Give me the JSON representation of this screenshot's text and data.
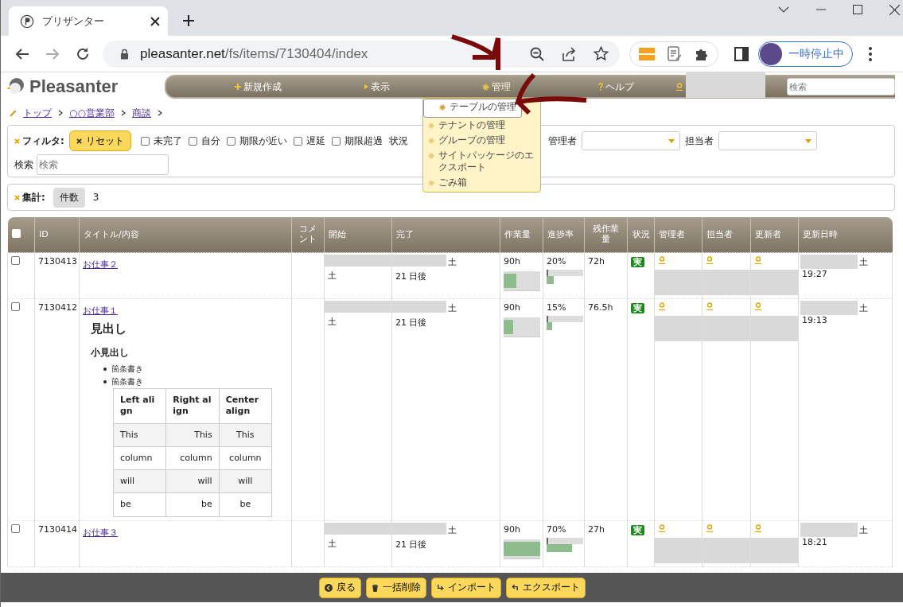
{
  "browser": {
    "tab_title": "プリザンター",
    "url_host": "pleasanter.net",
    "url_path": "/fs/items/7130404/index",
    "profile_label": "一時停止中"
  },
  "app": {
    "logo": "Pleasanter",
    "menu": [
      {
        "label": "新規作成",
        "kind": "plus",
        "expanded": false
      },
      {
        "label": "表示",
        "kind": "arrow",
        "expanded": false
      },
      {
        "label": "管理",
        "kind": "gear",
        "expanded": true
      },
      {
        "label": "ヘルプ",
        "kind": "help",
        "expanded": false
      }
    ],
    "search": {
      "placeholder": "検索"
    },
    "dropdown": [
      {
        "label": "テーブルの管理",
        "selected": true
      },
      {
        "label": "テナントの管理",
        "selected": false
      },
      {
        "label": "グループの管理",
        "selected": false
      },
      {
        "label": "サイトパッケージのエクスポート",
        "selected": false
      },
      {
        "label": "ごみ箱",
        "selected": false
      }
    ]
  },
  "breadcrumb": [
    "トップ",
    "○○営業部",
    "商談"
  ],
  "filter": {
    "label": "フィルタ:",
    "reset": "リセット",
    "checkboxes": [
      {
        "label": "未完了",
        "checked": false
      },
      {
        "label": "自分",
        "checked": false
      },
      {
        "label": "期限が近い",
        "checked": false
      },
      {
        "label": "遅延",
        "checked": false
      },
      {
        "label": "期限超過",
        "checked": false
      }
    ],
    "status_label": "状況",
    "manager_label": "管理者",
    "assignee_label": "担当者",
    "search_label": "検索",
    "search_placeholder": "検索"
  },
  "aggregate": {
    "label": "集計:",
    "chip": "件数",
    "value": "3"
  },
  "table": {
    "select_all_checked": false,
    "columns": [
      "ID",
      "タイトル/内容",
      "コメント",
      "開始",
      "完了",
      "作業量",
      "進捗率",
      "残作業量",
      "状況",
      "管理者",
      "担当者",
      "更新者",
      "更新日時"
    ],
    "rows": [
      {
        "checked": false,
        "id": "7130413",
        "title": "お仕事２",
        "start_day": "土",
        "end_day": "土",
        "end_rel": "21 日後",
        "work": "90h",
        "work_bar": {
          "level": 0.35
        },
        "progress": "20%",
        "progress_bar": {
          "level": 0.2
        },
        "remaining": "72h",
        "status": "実",
        "updated_day": "土",
        "updated_time": "19:27",
        "body": null
      },
      {
        "checked": false,
        "id": "7130412",
        "title": "お仕事１",
        "start_day": "土",
        "end_day": "土",
        "end_rel": "21 日後",
        "work": "90h",
        "work_bar": {
          "level": 0.25
        },
        "progress": "15%",
        "progress_bar": {
          "level": 0.15
        },
        "remaining": "76.5h",
        "status": "実",
        "updated_day": "土",
        "updated_time": "19:13",
        "body": {
          "heading": "見出し",
          "subheading": "小見出し",
          "bullets": [
            "箇条書き",
            "箇条書き"
          ],
          "md_table": {
            "header": [
              "Left align",
              "Right align",
              "Center align"
            ],
            "rows": [
              [
                "This",
                "This",
                "This"
              ],
              [
                "column",
                "column",
                "column"
              ],
              [
                "will",
                "will",
                "will"
              ],
              [
                "be",
                "be",
                "be"
              ]
            ]
          }
        }
      },
      {
        "checked": false,
        "id": "7130414",
        "title": "お仕事３",
        "start_day": "土",
        "end_day": "土",
        "end_rel": "21 日後",
        "work": "90h",
        "work_bar": {
          "level": 1.0
        },
        "progress": "70%",
        "progress_bar": {
          "level": 0.7
        },
        "remaining": "27h",
        "status": "実",
        "updated_day": "土",
        "updated_time": "18:21",
        "body": null
      }
    ]
  },
  "footer": [
    {
      "label": "戻る",
      "kind": "back"
    },
    {
      "label": "一括削除",
      "kind": "delete"
    },
    {
      "label": "インポート",
      "kind": "import"
    },
    {
      "label": "エクスポート",
      "kind": "export"
    }
  ]
}
